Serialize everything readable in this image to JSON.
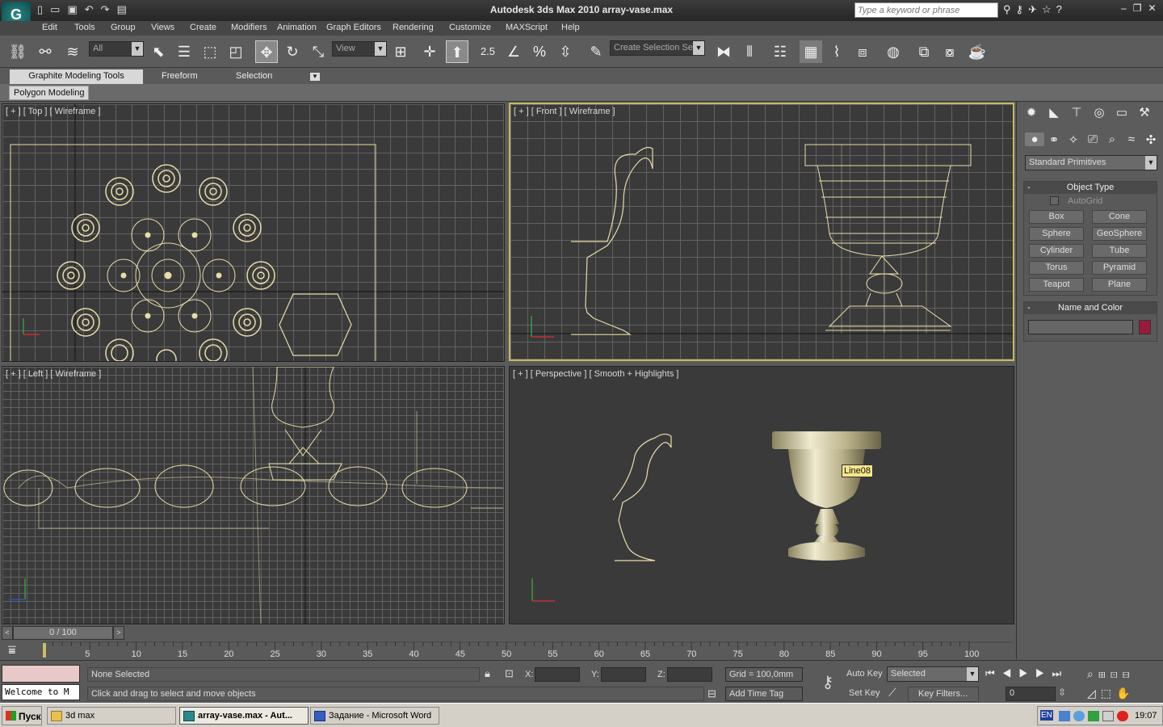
{
  "window": {
    "title": "Autodesk 3ds Max  2010       array-vase.max",
    "search_placeholder": "Type a keyword or phrase"
  },
  "menu": [
    "Edit",
    "Tools",
    "Group",
    "Views",
    "Create",
    "Modifiers",
    "Animation",
    "Graph Editors",
    "Rendering",
    "Customize",
    "MAXScript",
    "Help"
  ],
  "toolbar": {
    "filter": "All",
    "ref_coord": "View",
    "selection_set": "Create Selection Se",
    "snap_value": "2.5"
  },
  "ribbon": {
    "tabs": [
      "Graphite Modeling Tools",
      "Freeform",
      "Selection"
    ],
    "sub": "Polygon Modeling"
  },
  "viewports": {
    "top": "[ + ] [ Top ] [ Wireframe ]",
    "front": "[ + ] [ Front ] [ Wireframe ]",
    "left": "[ + ] [ Left ] [ Wireframe ]",
    "persp": "[ + ] [ Perspective ] [ Smooth + Highlights ]",
    "tooltip": "Line08"
  },
  "command_panel": {
    "category": "Standard Primitives",
    "object_type": "Object Type",
    "autogrid": "AutoGrid",
    "buttons": [
      "Box",
      "Cone",
      "Sphere",
      "GeoSphere",
      "Cylinder",
      "Tube",
      "Torus",
      "Pyramid",
      "Teapot",
      "Plane"
    ],
    "name_color": "Name and Color",
    "color": "#9a1a3c"
  },
  "timeline": {
    "frame": "0 / 100",
    "ticks": [
      "0",
      "5",
      "10",
      "15",
      "20",
      "25",
      "30",
      "35",
      "40",
      "45",
      "50",
      "55",
      "60",
      "65",
      "70",
      "75",
      "80",
      "85",
      "90",
      "95",
      "100"
    ]
  },
  "status": {
    "selection": "None Selected",
    "prompt": "Click and drag to select and move objects",
    "x": "X:",
    "y": "Y:",
    "z": "Z:",
    "grid": "Grid = 100,0mm",
    "add_time_tag": "Add Time Tag",
    "auto_key": "Auto Key",
    "set_key": "Set Key",
    "selected": "Selected",
    "key_filters": "Key Filters...",
    "frame": "0",
    "welcome": "Welcome to M"
  },
  "taskbar": {
    "start": "Пуск",
    "items": [
      "3d max",
      "array-vase.max - Aut...",
      "Задание - Microsoft Word"
    ],
    "lang": "EN",
    "clock": "19:07"
  }
}
